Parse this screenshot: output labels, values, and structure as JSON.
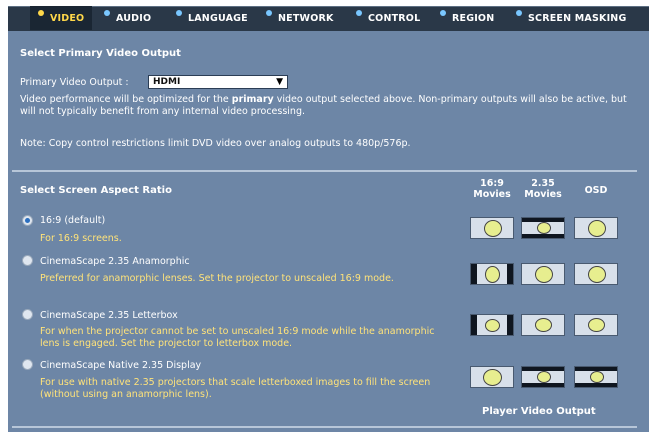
{
  "tabs": [
    {
      "label": "VIDEO",
      "active": true
    },
    {
      "label": "AUDIO",
      "active": false
    },
    {
      "label": "LANGUAGE",
      "active": false
    },
    {
      "label": "NETWORK",
      "active": false
    },
    {
      "label": "CONTROL",
      "active": false
    },
    {
      "label": "REGION",
      "active": false
    },
    {
      "label": "SCREEN MASKING",
      "active": false
    }
  ],
  "primary": {
    "heading": "Select Primary Video Output",
    "label": "Primary Video Output :",
    "selected": "HDMI",
    "desc_pre": "Video performance will be optimized for the ",
    "desc_bold": "primary",
    "desc_post": " video output selected above. Non-primary outputs will also be active, but will not typically benefit from any internal video processing.",
    "note": "Note: Copy control restrictions limit DVD video over analog outputs to 480p/576p."
  },
  "aspect": {
    "heading": "Select Screen Aspect Ratio",
    "columns": [
      {
        "line1": "16:9",
        "line2": "Movies"
      },
      {
        "line1": "2.35",
        "line2": "Movies"
      },
      {
        "line1": "OSD",
        "line2": ""
      }
    ],
    "options": [
      {
        "title": "16:9 (default)",
        "desc": "For 16:9 screens.",
        "selected": true
      },
      {
        "title": "CinemaScape 2.35 Anamorphic",
        "desc": "Preferred for anamorphic lenses. Set the projector to unscaled 16:9 mode.",
        "selected": false
      },
      {
        "title": "CinemaScape 2.35 Letterbox",
        "desc": "For when the projector cannot be set to unscaled 16:9 mode while the anamorphic lens is engaged. Set the projector to letterbox mode.",
        "selected": false
      },
      {
        "title": "CinemaScape Native 2.35 Display",
        "desc": "For use with native 2.35 projectors that scale letterboxed images to fill the screen (without using an anamorphic lens).",
        "selected": false
      }
    ],
    "footer": "Player Video Output"
  },
  "colors": {
    "panel": "#6d86a6",
    "tabbar": "#2a3848",
    "active_tab_text": "#ffd84a",
    "inactive_dot": "#7ac7ff",
    "option_desc": "#ffe37a"
  }
}
